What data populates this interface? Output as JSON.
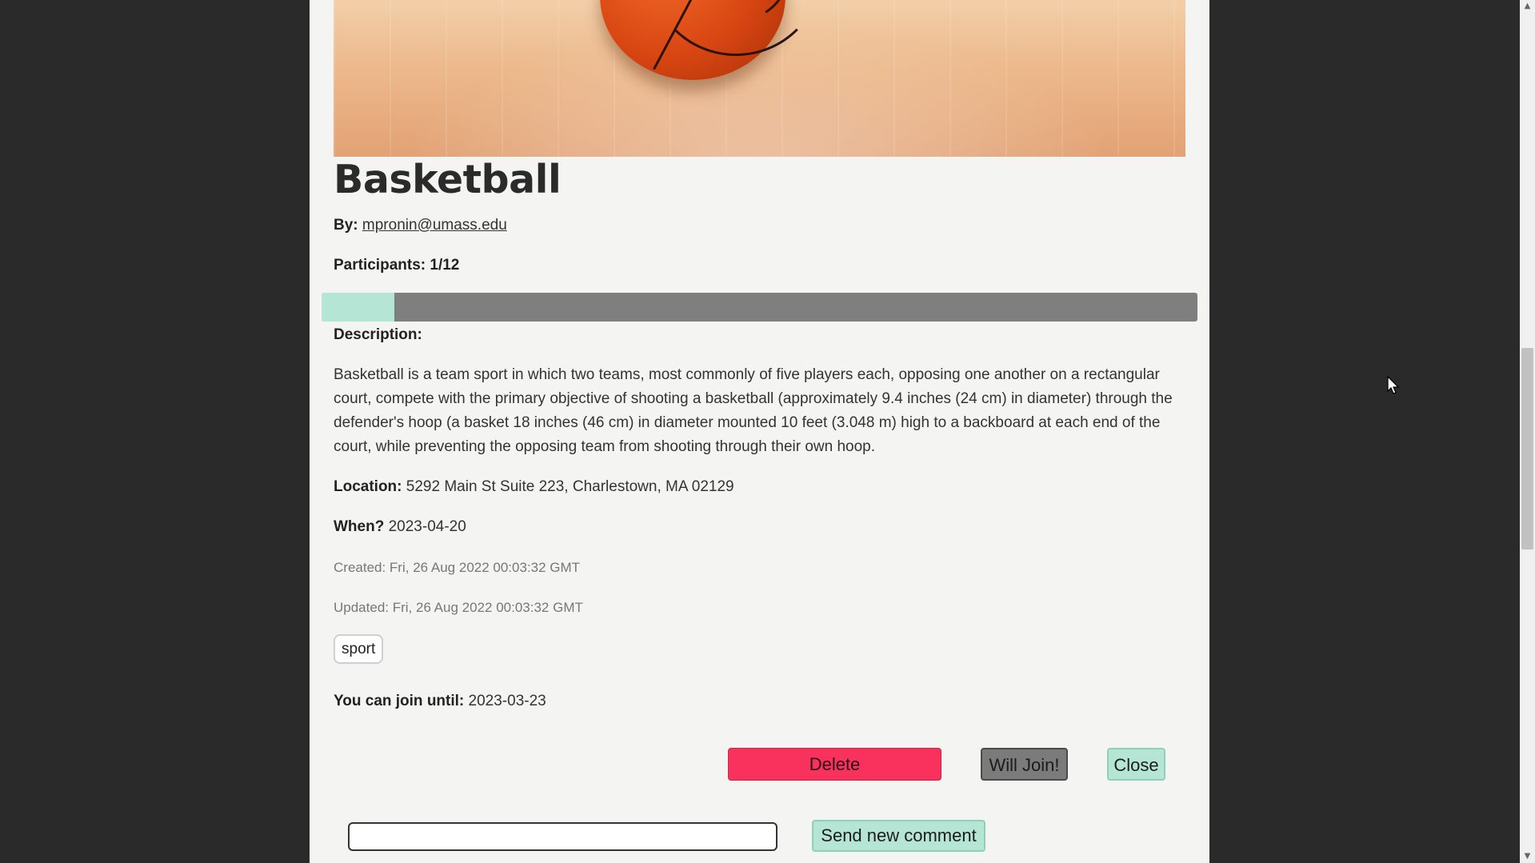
{
  "event": {
    "title": "Basketball",
    "by_label": "By:",
    "author": "mpronin@umass.edu",
    "participants_label": "Participants:",
    "participants_value": "1/12",
    "participants_fraction": 0.0833,
    "description_label": "Description:",
    "description": "Basketball is a team sport in which two teams, most commonly of five players each, opposing one another on a rectangular court, compete with the primary objective of shooting a basketball (approximately 9.4 inches (24 cm) in diameter) through the defender's hoop (a basket 18 inches (46 cm) in diameter mounted 10 feet (3.048 m) high to a backboard at each end of the court, while preventing the opposing team from shooting through their own hoop.",
    "location_label": "Location:",
    "location": "5292 Main St Suite 223, Charlestown, MA 02129",
    "when_label": "When?",
    "when": "2023-04-20",
    "created": "Created: Fri, 26 Aug 2022 00:03:32 GMT",
    "updated": "Updated: Fri, 26 Aug 2022 00:03:32 GMT",
    "tags": [
      "sport"
    ],
    "join_until_label": "You can join until:",
    "join_until": "2023-03-23"
  },
  "actions": {
    "delete_label": "Delete",
    "will_join_label": "Will Join!",
    "close_label": "Close",
    "send_comment_label": "Send new comment"
  },
  "comment": {
    "value": "",
    "placeholder": ""
  },
  "colors": {
    "accent": "#b4e5d5",
    "danger": "#f8325c",
    "progress_track": "#7f7f7f",
    "backdrop": "#2a2a2a",
    "panel": "#f4f4f3"
  },
  "icons": {
    "cursor": "arrow-cursor-icon",
    "scroll_up": "chevron-up-icon",
    "scroll_down": "chevron-down-icon"
  }
}
